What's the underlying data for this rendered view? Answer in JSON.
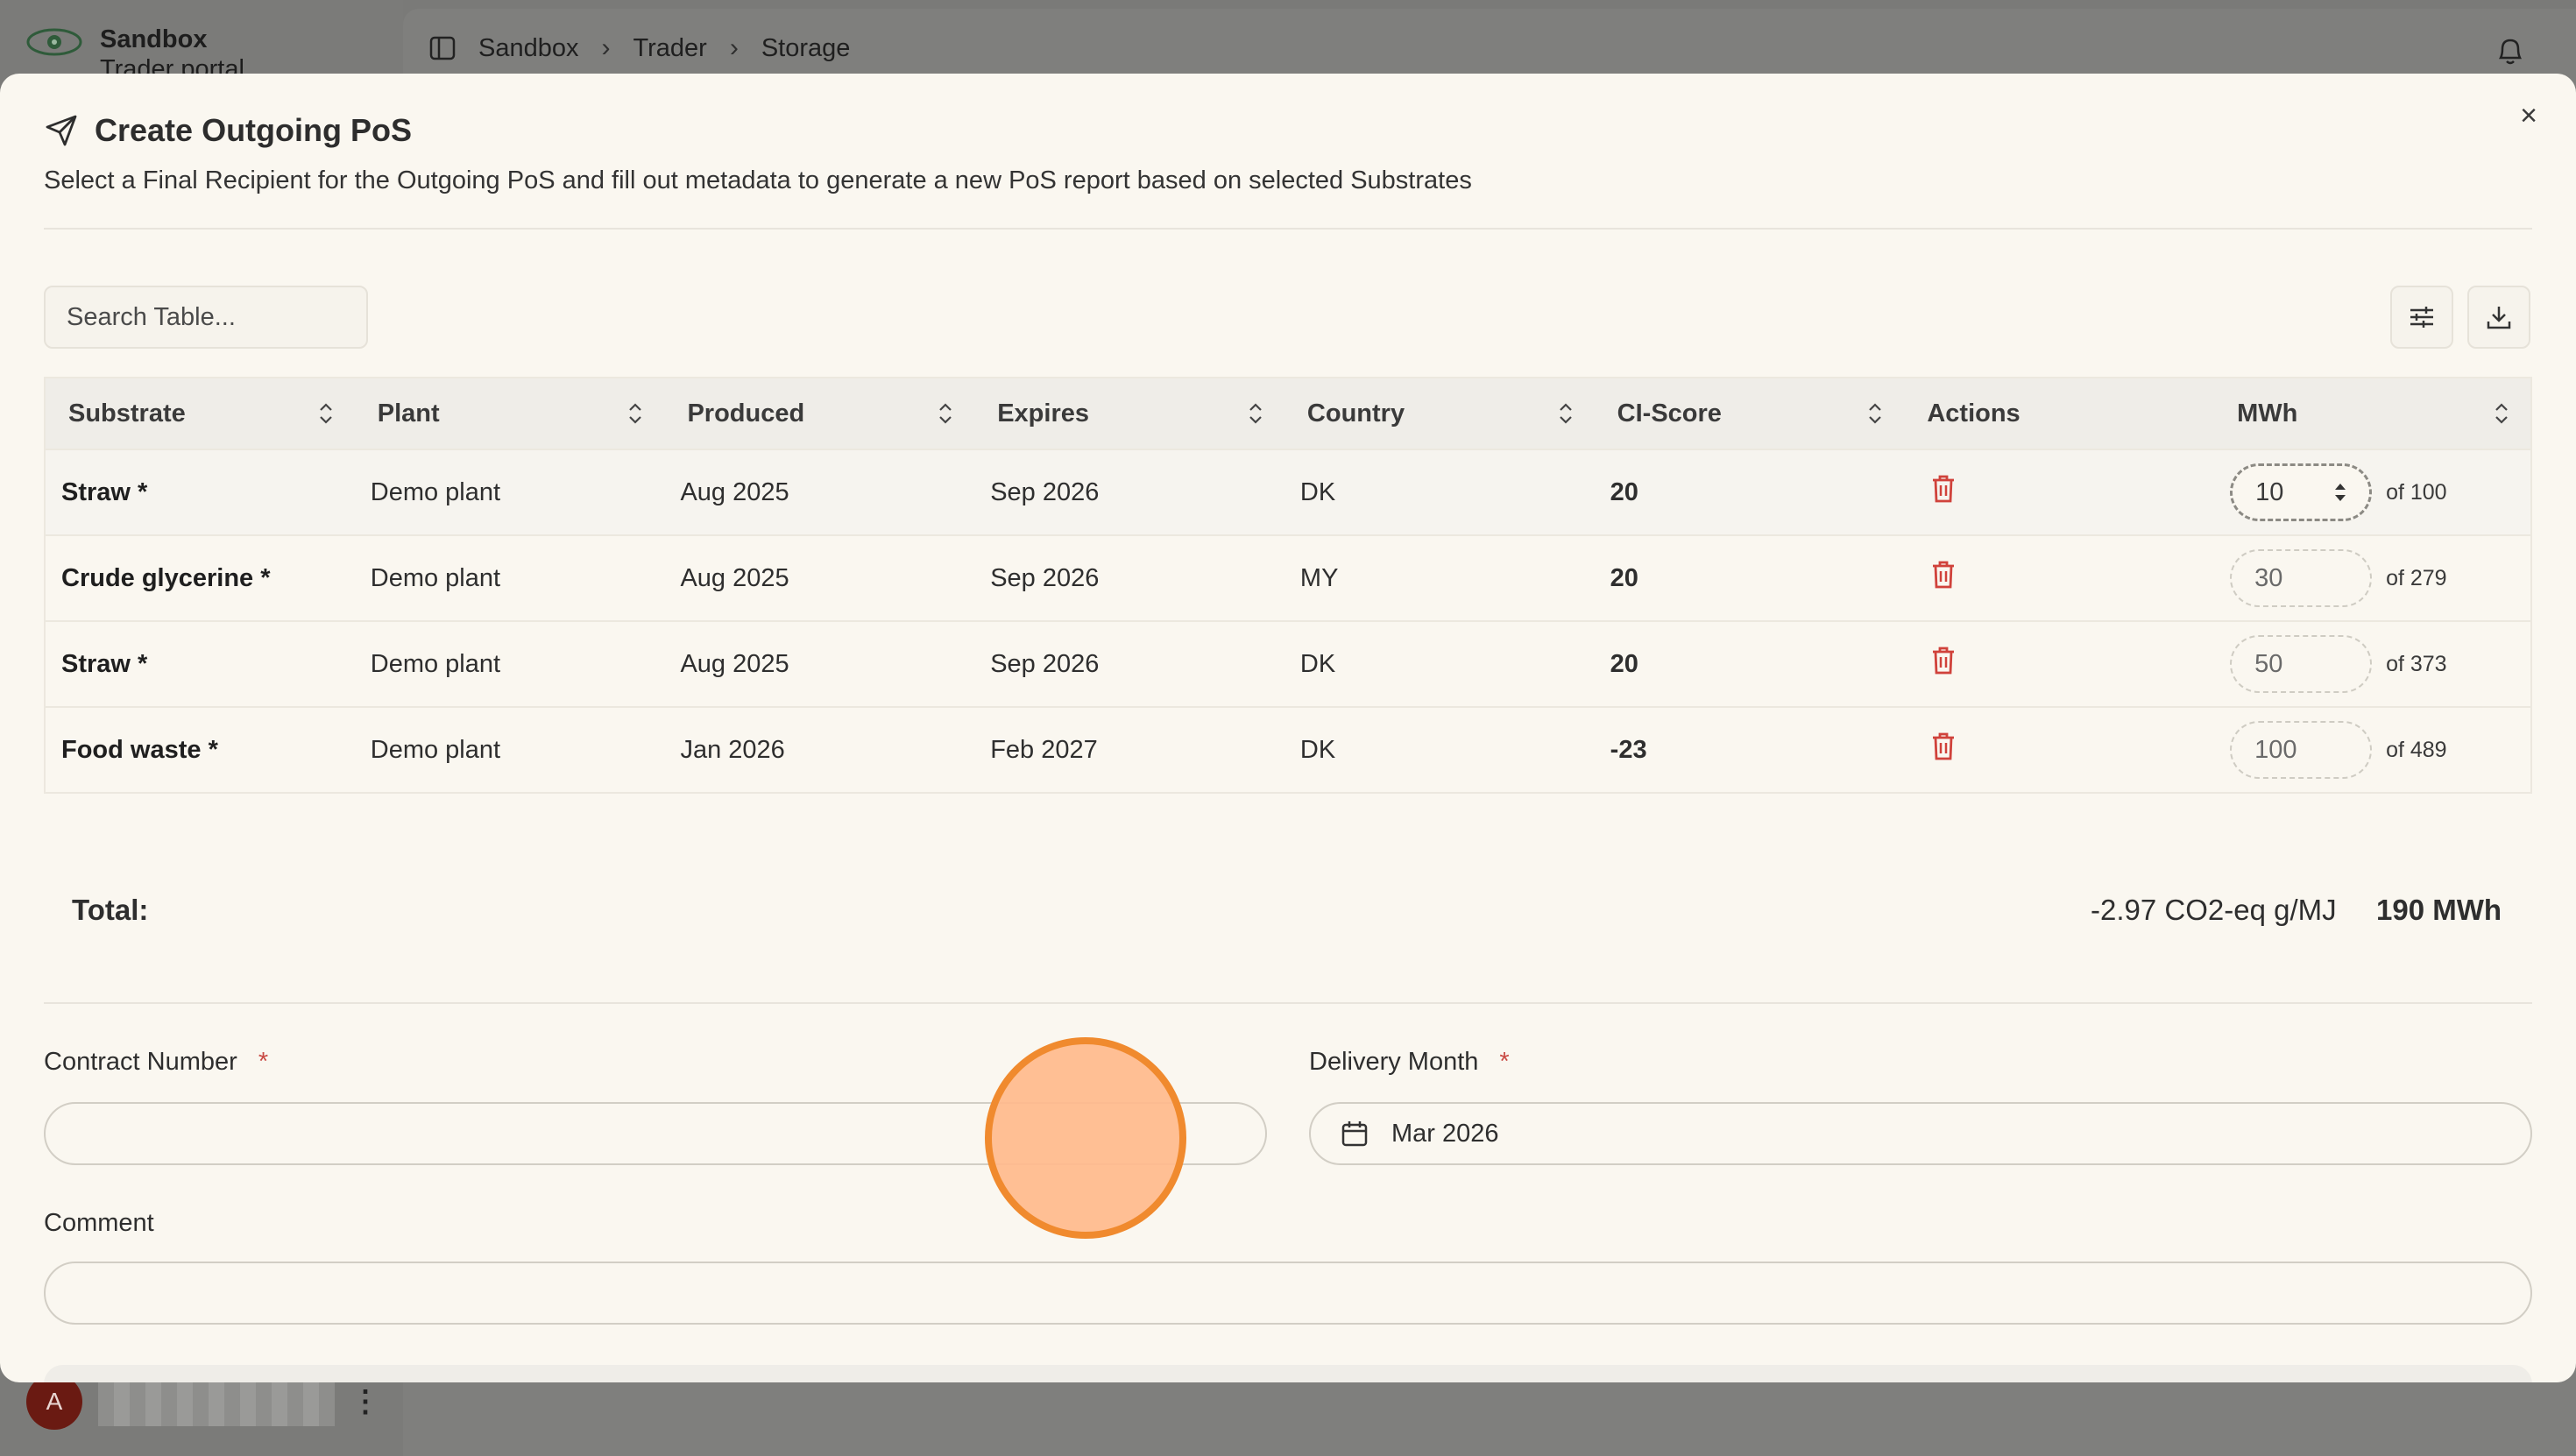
{
  "app": {
    "brand_title": "Sandbox",
    "brand_subtitle": "Trader portal",
    "breadcrumb": [
      "Sandbox",
      "Trader",
      "Storage"
    ],
    "user_initial": "A"
  },
  "modal": {
    "title": "Create Outgoing PoS",
    "description": "Select a Final Recipient for the Outgoing PoS and fill out metadata to generate a new PoS report based on selected Substrates",
    "search_placeholder": "Search Table...",
    "columns": [
      "Substrate",
      "Plant",
      "Produced",
      "Expires",
      "Country",
      "CI-Score",
      "Actions",
      "MWh"
    ],
    "rows": [
      {
        "substrate": "Straw *",
        "plant": "Demo plant",
        "produced": "Aug 2025",
        "expires": "Sep 2026",
        "country": "DK",
        "ci_score": "20",
        "mwh": "10",
        "of": "of 100"
      },
      {
        "substrate": "Crude glycerine *",
        "plant": "Demo plant",
        "produced": "Aug 2025",
        "expires": "Sep 2026",
        "country": "MY",
        "ci_score": "20",
        "mwh": "30",
        "of": "of 279"
      },
      {
        "substrate": "Straw *",
        "plant": "Demo plant",
        "produced": "Aug 2025",
        "expires": "Sep 2026",
        "country": "DK",
        "ci_score": "20",
        "mwh": "50",
        "of": "of 373"
      },
      {
        "substrate": "Food waste *",
        "plant": "Demo plant",
        "produced": "Jan 2026",
        "expires": "Feb 2027",
        "country": "DK",
        "ci_score": "-23",
        "mwh": "100",
        "of": "of 489"
      }
    ],
    "total_label": "Total:",
    "total_ci": "-2.97 CO2-eq g/MJ",
    "total_mwh": "190 MWh",
    "contract_label": "Contract Number",
    "contract_value": "",
    "delivery_label": "Delivery Month",
    "delivery_value": "Mar 2026",
    "required_mark": "*",
    "comment_label": "Comment",
    "comment_value": "",
    "close_glyph": "×"
  },
  "colors": {
    "modal_bg": "#faf7f0",
    "score_positive": "#c94a44",
    "score_negative": "#2f7a3b",
    "trash": "#d0423b",
    "touch_indicator": "#f08a2e"
  }
}
